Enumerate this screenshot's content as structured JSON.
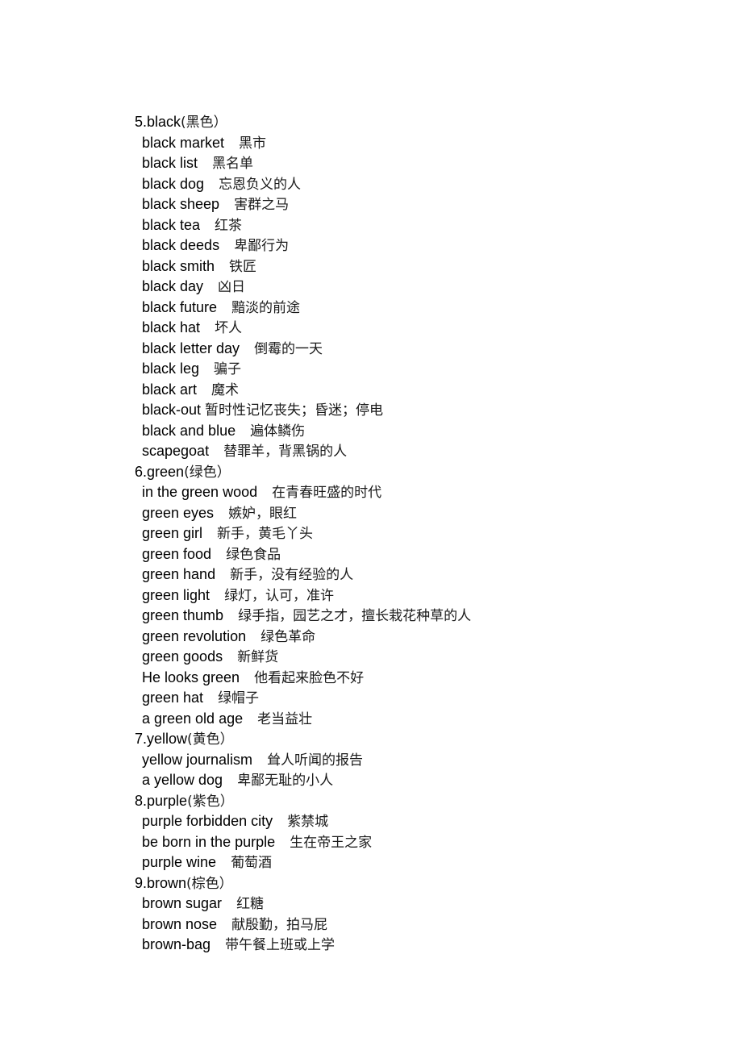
{
  "sections": [
    {
      "heading": "5.black",
      "heading_zh": "(黑色）",
      "entries": [
        {
          "en": "black market",
          "zh": "黑市"
        },
        {
          "en": "black list",
          "zh": "黑名单"
        },
        {
          "en": "black dog",
          "zh": "忘恩负义的人"
        },
        {
          "en": "black sheep",
          "zh": "害群之马"
        },
        {
          "en": "black tea",
          "zh": "红茶"
        },
        {
          "en": "black deeds",
          "zh": "卑鄙行为"
        },
        {
          "en": "black smith",
          "zh": "铁匠"
        },
        {
          "en": "black day",
          "zh": "凶日"
        },
        {
          "en": "black future",
          "zh": "黯淡的前途"
        },
        {
          "en": "black hat",
          "zh": "坏人"
        },
        {
          "en": "black letter day",
          "zh": "倒霉的一天"
        },
        {
          "en": "black leg",
          "zh": "骗子"
        },
        {
          "en": "black art",
          "zh": "魔术"
        },
        {
          "en": "black-out",
          "zh": "暂时性记忆丧失；昏迷；停电",
          "tight": true
        },
        {
          "en": "black and blue",
          "zh": "遍体鳞伤"
        },
        {
          "en": "scapegoat",
          "zh": "替罪羊，背黑锅的人"
        }
      ]
    },
    {
      "heading": "6.green",
      "heading_zh": "(绿色）",
      "entries": [
        {
          "en": "in the green wood",
          "zh": "在青春旺盛的时代"
        },
        {
          "en": "green eyes",
          "zh": "嫉妒，眼红"
        },
        {
          "en": "green girl",
          "zh": "新手，黄毛丫头"
        },
        {
          "en": "green food",
          "zh": "绿色食品"
        },
        {
          "en": "green hand",
          "zh": "新手，没有经验的人"
        },
        {
          "en": "green light",
          "zh": "绿灯，认可，准许"
        },
        {
          "en": "green thumb",
          "zh": "绿手指，园艺之才，擅长栽花种草的人"
        },
        {
          "en": "green revolution",
          "zh": "绿色革命"
        },
        {
          "en": "green goods",
          "zh": "新鲜货"
        },
        {
          "en": "He looks green",
          "zh": "他看起来脸色不好"
        },
        {
          "en": "green hat",
          "zh": "绿帽子"
        },
        {
          "en": "a green old age",
          "zh": "老当益壮"
        }
      ]
    },
    {
      "heading": "7.yellow",
      "heading_zh": "(黄色）",
      "entries": [
        {
          "en": "yellow journalism",
          "zh": "耸人听闻的报告"
        },
        {
          "en": "a yellow dog",
          "zh": "卑鄙无耻的小人"
        }
      ]
    },
    {
      "heading": "8.purple",
      "heading_zh": "(紫色）",
      "entries": [
        {
          "en": "purple forbidden city",
          "zh": "紫禁城"
        },
        {
          "en": "be born in the purple",
          "zh": "生在帝王之家"
        },
        {
          "en": "purple wine",
          "zh": "葡萄酒"
        }
      ]
    },
    {
      "heading": "9.brown",
      "heading_zh": "(棕色）",
      "entries": [
        {
          "en": "brown sugar",
          "zh": "红糖"
        },
        {
          "en": "brown nose",
          "zh": "献殷勤，拍马屁"
        },
        {
          "en": "brown-bag",
          "zh": "带午餐上班或上学"
        }
      ]
    }
  ]
}
